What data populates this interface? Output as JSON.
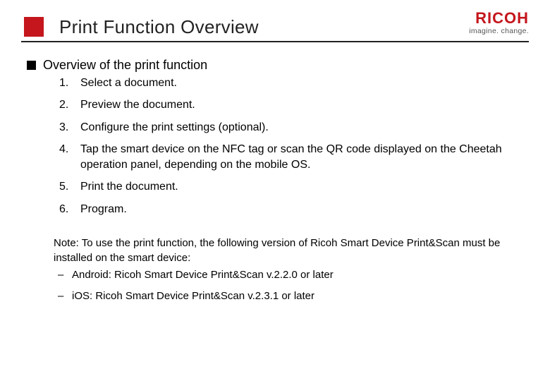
{
  "header": {
    "title": "Print Function Overview",
    "logo_text": "RICOH",
    "logo_tagline": "imagine. change."
  },
  "section": {
    "heading": "Overview of the print function",
    "steps": [
      {
        "num": "1.",
        "text": "Select a document."
      },
      {
        "num": "2.",
        "text": "Preview the document."
      },
      {
        "num": "3.",
        "text": "Configure the print settings (optional)."
      },
      {
        "num": "4.",
        "text": "Tap the smart device on the NFC tag or scan the QR code displayed on the Cheetah operation panel, depending on the mobile OS."
      },
      {
        "num": "5.",
        "text": "Print the document."
      },
      {
        "num": "6.",
        "text": "Program."
      }
    ]
  },
  "note": {
    "lead": "Note: To use the print function, the following version of Ricoh Smart Device Print&Scan must be installed on the smart device:",
    "items": [
      "Android: Ricoh Smart Device Print&Scan v.2.2.0 or later",
      "iOS: Ricoh Smart Device Print&Scan v.2.3.1 or later"
    ]
  }
}
